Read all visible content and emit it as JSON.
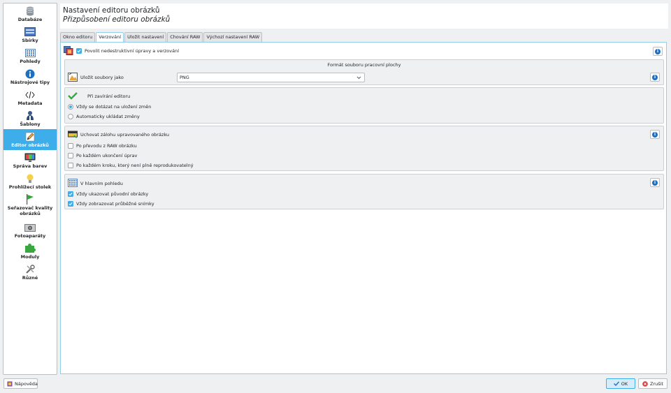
{
  "sidebar": {
    "items": [
      {
        "label": "Databáze",
        "icon": "database-icon"
      },
      {
        "label": "Sbírky",
        "icon": "collections-icon"
      },
      {
        "label": "Pohledy",
        "icon": "views-icon"
      },
      {
        "label": "Nástrojové tipy",
        "icon": "info-icon"
      },
      {
        "label": "Metadata",
        "icon": "code-icon"
      },
      {
        "label": "Šablony",
        "icon": "person-icon"
      },
      {
        "label": "Editor obrázků",
        "icon": "pencil-icon"
      },
      {
        "label": "Správa barev",
        "icon": "monitor-icon"
      },
      {
        "label": "Prohlížecí stolek",
        "icon": "lightbulb-icon"
      },
      {
        "label": "Seřazovač kvality obrázků",
        "icon": "flag-icon"
      },
      {
        "label": "Fotoaparáty",
        "icon": "camera-icon"
      },
      {
        "label": "Moduly",
        "icon": "puzzle-icon"
      },
      {
        "label": "Různé",
        "icon": "tools-icon"
      }
    ]
  },
  "header": {
    "title": "Nastavení editoru obrázků",
    "subtitle": "Přizpůsobení editoru obrázků"
  },
  "tabs": [
    {
      "label": "Okno editoru"
    },
    {
      "label": "Verzování"
    },
    {
      "label": "Uložit nastavení"
    },
    {
      "label": "Chování RAW"
    },
    {
      "label": "Výchozí nastavení RAW"
    }
  ],
  "versioning": {
    "enable_label": "Povolit nedestruktivní úpravy a verzování",
    "format_title": "Formát souboru pracovní plochy",
    "save_as_label": "Uložit soubory jako",
    "save_as_value": "PNG",
    "closing_title": "Při zavírání editoru",
    "always_ask_label": "Vždy se dotázat na uložení změn",
    "auto_save_label": "Automaticky ukládat změny",
    "backup_title": "Uchovat zálohu upravovaného obrázku",
    "after_raw_label": "Po převodu z RAW obrázku",
    "each_session_label": "Po každém ukončení úprav",
    "each_step_label": "Po každém kroku, který není plně reprodukovatelný",
    "main_view_title": "V hlavním pohledu",
    "show_original_label": "Vždy ukazovat původní obrázky",
    "show_intermediate_label": "Vždy zobrazovat průběžné snímky"
  },
  "footer": {
    "help_label": "Nápověda",
    "ok_label": "OK",
    "cancel_label": "Zrušit"
  }
}
